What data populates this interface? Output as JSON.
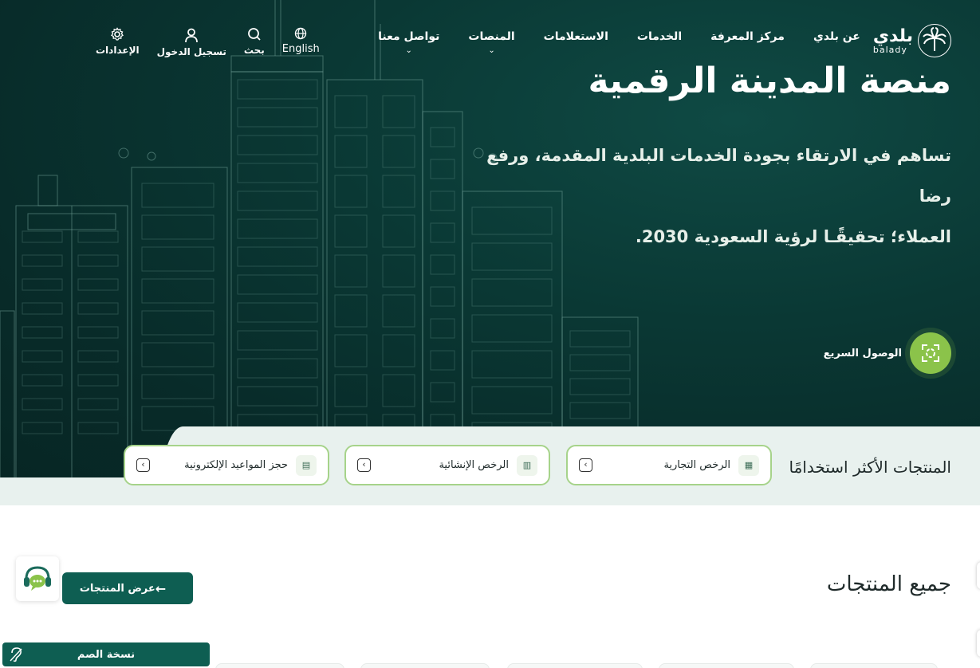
{
  "header": {
    "logo": {
      "ar": "بلدي",
      "en": "balady"
    },
    "nav": [
      {
        "label": "عن بلدي",
        "has_dropdown": false
      },
      {
        "label": "مركز المعرفة",
        "has_dropdown": false
      },
      {
        "label": "الخدمات",
        "has_dropdown": false
      },
      {
        "label": "الاستعلامات",
        "has_dropdown": false
      },
      {
        "label": "المنصات",
        "has_dropdown": true
      },
      {
        "label": "تواصل معنا",
        "has_dropdown": true
      }
    ],
    "utils": {
      "language": "English",
      "search": "بحث",
      "login": "تسجيل الدخول",
      "settings": "الإعدادات"
    }
  },
  "hero": {
    "title": "منصة المدينة الرقمية",
    "description_line1": "تساهم في الارتقاء بجودة الخدمات البلدية المقدمة، ورفع رضا",
    "description_line2": "العملاء؛ تحقيقًـا لرؤية السعودية 2030.",
    "quick_access": "الوصول السريع"
  },
  "most_used": {
    "title": "المنتجات الأكثر استخدامًا",
    "items": [
      {
        "label": "الرخص التجارية",
        "icon": "license-icon"
      },
      {
        "label": "الرخص الإنشائية",
        "icon": "building-license-icon"
      },
      {
        "label": "حجز المواعيد الإلكترونية",
        "icon": "appointment-icon"
      }
    ]
  },
  "all_products": {
    "title": "جميع المنتجات",
    "view_button": "عرض المنتجات"
  },
  "accessibility": {
    "deaf_version": "نسخة الصم"
  },
  "colors": {
    "hero_dark": "#082b29",
    "primary": "#0e5e52",
    "accent_green": "#8bc34a",
    "card_border": "#a6d38a",
    "bar_bg": "#e8f1ee"
  }
}
